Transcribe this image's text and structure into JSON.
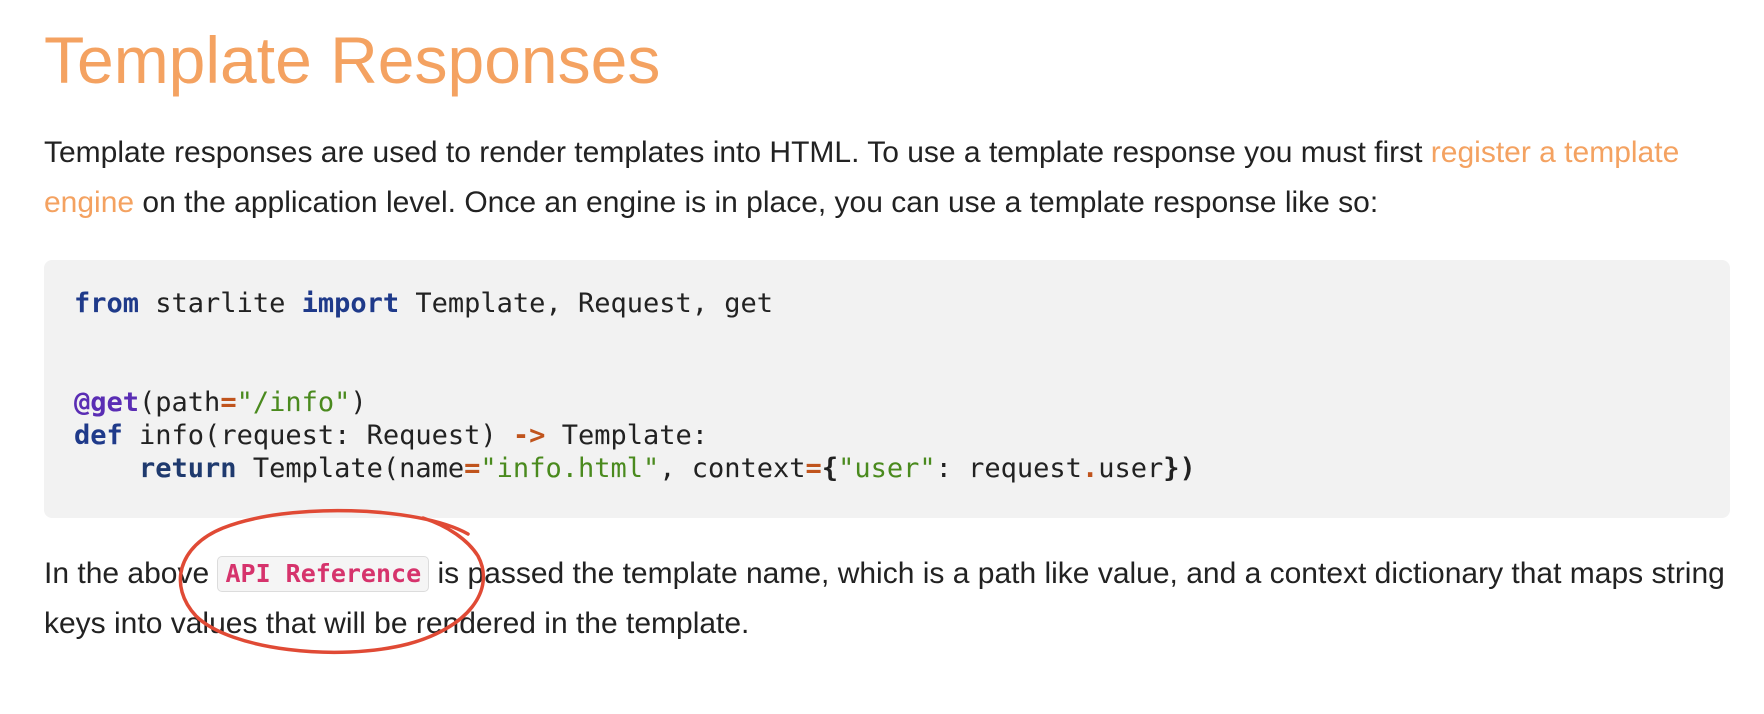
{
  "page": {
    "title": "Template Responses"
  },
  "intro": {
    "text_before_link": "Template responses are used to render templates into HTML. To use a template response you must first ",
    "link_text": "register a template engine",
    "text_after_link": " on the application level. Once an engine is in place, you can use a template response like so:"
  },
  "code": {
    "line1": {
      "kw_from": "from",
      "module": " starlite ",
      "kw_import": "import",
      "names": " Template, Request, get"
    },
    "line2": {
      "decorator": "@get",
      "open": "(path",
      "eq": "=",
      "path_str": "\"/info\"",
      "close": ")"
    },
    "line3": {
      "kw_def": "def",
      "signature": " info(request: Request) ",
      "arrow": "->",
      "ret_type": " Template:"
    },
    "line4": {
      "indent": "    ",
      "kw_return": "return",
      "call_open": " Template(name",
      "eq1": "=",
      "name_str": "\"info.html\"",
      "ctx_part": ", context",
      "eq2": "=",
      "brace_open": "{",
      "user_key": "\"user\"",
      "colon_part": ": request",
      "dot": ".",
      "attr": "user",
      "brace_close": "})"
    }
  },
  "outro": {
    "text_before": "In the above ",
    "api_reference": "API Reference",
    "text_after": " is passed the template name, which is a path like value, and a context dictionary that maps string keys into values that will be rendered in the template."
  },
  "colors": {
    "accent": "#f4a261",
    "annotation": "#e04a35",
    "inline_code": "#d6336c",
    "code_background": "#f2f2f2"
  }
}
